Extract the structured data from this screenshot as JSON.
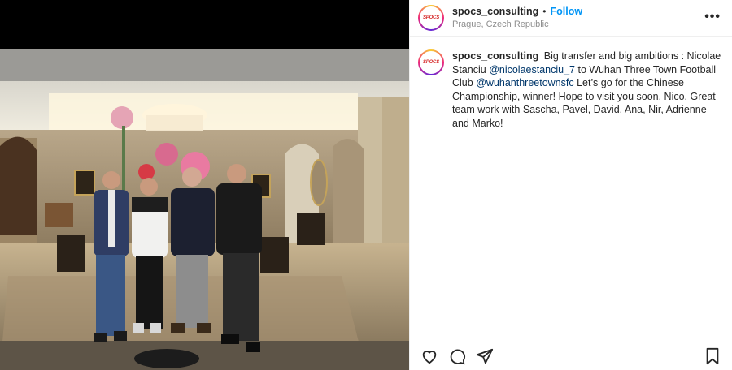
{
  "post": {
    "username": "spocs_consulting",
    "follow_label": "Follow",
    "separator": "•",
    "location": "Prague, Czech Republic",
    "avatar_text": "SPOCS",
    "more_icon": "more-icon",
    "caption": {
      "text_1": "Big transfer and big ambitions : Nicolae Stanciu",
      "mention_1": "@nicolaestanciu_7",
      "text_2": "to Wuhan Three Town Football Club",
      "mention_2": "@wuhanthreetownsfc",
      "text_3": "Let’s go for the Chinese Championship, winner! Hope to visit you soon, Nico. Great team work with Sascha, Pavel, David, Ana, Nir, Adrienne and Marko!"
    },
    "actions": [
      "heart-icon",
      "comment-icon",
      "share-icon",
      "bookmark-icon"
    ]
  },
  "colors": {
    "link": "#0095f6",
    "mention": "#00376b",
    "text": "#262626",
    "muted": "#8e8e8e"
  }
}
